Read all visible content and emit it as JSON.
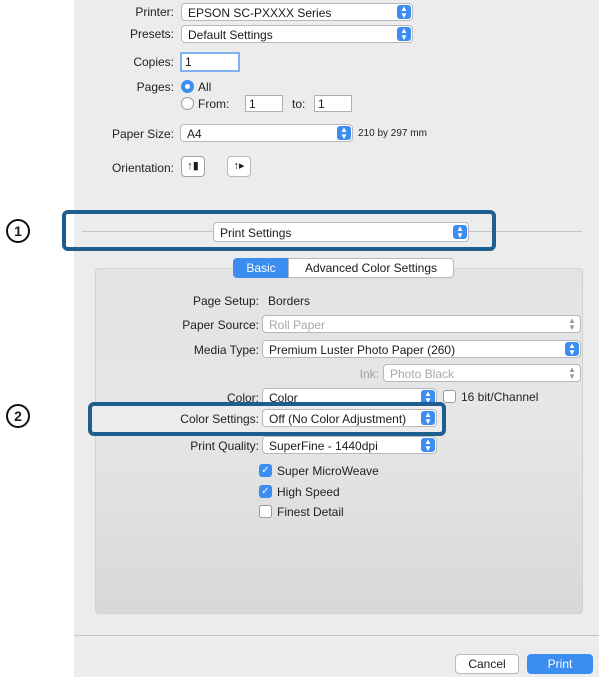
{
  "printer": {
    "label": "Printer:",
    "value": "EPSON SC-PXXXX Series"
  },
  "presets": {
    "label": "Presets:",
    "value": "Default Settings"
  },
  "copies": {
    "label": "Copies:",
    "value": "1"
  },
  "pages": {
    "label": "Pages:",
    "all_label": "All",
    "from_label": "From:",
    "from_value": "1",
    "to_label": "to:",
    "to_value": "1"
  },
  "paper_size": {
    "label": "Paper Size:",
    "value": "A4",
    "dimensions": "210 by 297 mm"
  },
  "orientation": {
    "label": "Orientation:"
  },
  "section_popup": {
    "value": "Print Settings"
  },
  "tabs": {
    "basic": "Basic",
    "advanced": "Advanced Color Settings"
  },
  "settings": {
    "page_setup": {
      "label": "Page Setup:",
      "value": "Borders"
    },
    "paper_source": {
      "label": "Paper Source:",
      "value": "Roll Paper"
    },
    "media_type": {
      "label": "Media Type:",
      "value": "Premium Luster Photo Paper (260)"
    },
    "ink": {
      "label": "Ink:",
      "value": "Photo Black"
    },
    "color": {
      "label": "Color:",
      "value": "Color"
    },
    "bit_channel": "16 bit/Channel",
    "color_settings": {
      "label": "Color Settings:",
      "value": "Off (No Color Adjustment)"
    },
    "print_quality": {
      "label": "Print Quality:",
      "value": "SuperFine - 1440dpi"
    },
    "super_microweave": "Super MicroWeave",
    "high_speed": "High Speed",
    "finest_detail": "Finest Detail"
  },
  "buttons": {
    "cancel": "Cancel",
    "print": "Print"
  },
  "callouts": {
    "one": "1",
    "two": "2"
  },
  "colors": {
    "accent": "#3b8df2",
    "callout_border": "#1d5e8f"
  }
}
